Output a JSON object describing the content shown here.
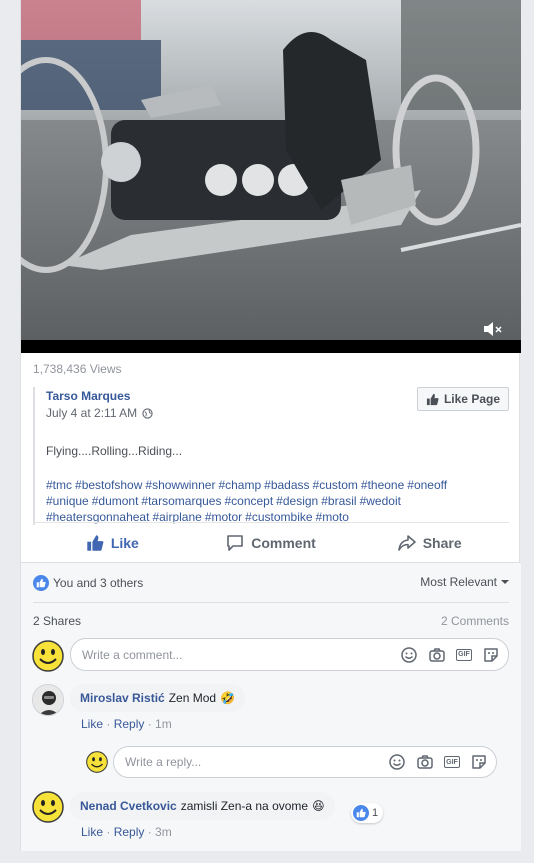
{
  "video": {
    "views": "1,738,436 Views"
  },
  "post": {
    "author": "Tarso Marques",
    "time": "July 4 at 2:11 AM",
    "like_page_label": "Like Page",
    "message": "Flying....Rolling...Riding...",
    "hashtags": [
      "#tmc",
      "#bestofshow",
      "#showwinner",
      "#champ",
      "#badass",
      "#custom",
      "#theone",
      "#oneoff",
      "#unique",
      "#dumont",
      "#tarsomarques",
      "#concept",
      "#design",
      "#brasil",
      "#wedoit",
      "#heatersgonnaheat",
      "#airplane",
      "#motor",
      "#custombike",
      "#moto"
    ]
  },
  "actions": {
    "like": "Like",
    "comment": "Comment",
    "share": "Share"
  },
  "reactions": {
    "summary": "You and 3 others",
    "sort": "Most Relevant"
  },
  "stats": {
    "shares": "2 Shares",
    "comments": "2 Comments"
  },
  "comment_input": {
    "placeholder": "Write a comment..."
  },
  "comments": [
    {
      "name": "Miroslav Ristić",
      "text": "Zen Mod",
      "emoji": "🤣",
      "like": "Like",
      "reply": "Reply",
      "age": "1m"
    },
    {
      "name": "Nenad Cvetkovic",
      "text": "zamisli Zen-a na ovome",
      "emoji": "😆",
      "like": "Like",
      "reply": "Reply",
      "age": "3m",
      "reaction_count": "1"
    }
  ],
  "reply_input": {
    "placeholder": "Write a reply..."
  },
  "colors": {
    "link": "#365899",
    "like_blue": "#4267b2",
    "background": "#e9ebee"
  }
}
